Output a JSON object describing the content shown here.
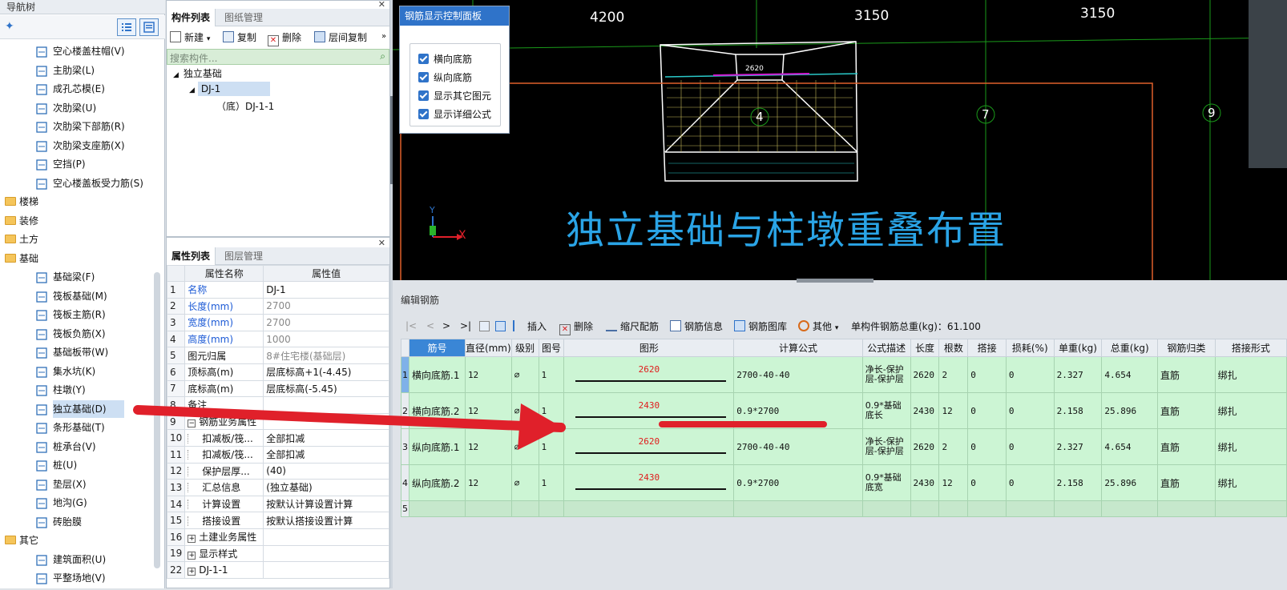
{
  "nav": {
    "title": "导航树",
    "items": [
      {
        "label": "空心楼盖柱帽(V)",
        "icon": "column-cap-icon"
      },
      {
        "label": "主肋梁(L)",
        "icon": "main-rib-beam-icon"
      },
      {
        "label": "成孔芯模(E)",
        "icon": "hole-core-mold-icon"
      },
      {
        "label": "次肋梁(U)",
        "icon": "secondary-rib-beam-icon"
      },
      {
        "label": "次肋梁下部筋(R)",
        "icon": "beam-bottom-rebar-icon"
      },
      {
        "label": "次肋梁支座筋(X)",
        "icon": "beam-support-rebar-icon"
      },
      {
        "label": "空挡(P)",
        "icon": "gap-icon"
      },
      {
        "label": "空心楼盖板受力筋(S)",
        "icon": "slab-rebar-icon"
      }
    ],
    "groups_top": [
      {
        "label": "楼梯"
      },
      {
        "label": "装修"
      },
      {
        "label": "土方"
      },
      {
        "label": "基础"
      }
    ],
    "foundation_items": [
      {
        "label": "基础梁(F)",
        "icon": "foundation-beam-icon"
      },
      {
        "label": "筏板基础(M)",
        "icon": "raft-foundation-icon"
      },
      {
        "label": "筏板主筋(R)",
        "icon": "raft-main-rebar-icon"
      },
      {
        "label": "筏板负筋(X)",
        "icon": "raft-negative-rebar-icon"
      },
      {
        "label": "基础板带(W)",
        "icon": "foundation-strip-icon"
      },
      {
        "label": "集水坑(K)",
        "icon": "sump-icon"
      },
      {
        "label": "柱墩(Y)",
        "icon": "column-pier-icon"
      },
      {
        "label": "独立基础(D)",
        "icon": "isolated-footing-icon",
        "selected": true
      },
      {
        "label": "条形基础(T)",
        "icon": "strip-footing-icon"
      },
      {
        "label": "桩承台(V)",
        "icon": "pile-cap-icon"
      },
      {
        "label": "桩(U)",
        "icon": "pile-icon"
      },
      {
        "label": "垫层(X)",
        "icon": "cushion-icon"
      },
      {
        "label": "地沟(G)",
        "icon": "trench-icon"
      },
      {
        "label": "砖胎膜",
        "icon": "brick-mold-icon"
      }
    ],
    "group_other": "其它",
    "other_items": [
      {
        "label": "建筑面积(U)",
        "icon": "building-area-icon"
      },
      {
        "label": "平整场地(V)",
        "icon": "site-leveling-icon"
      }
    ]
  },
  "component": {
    "tabs": [
      "构件列表",
      "图纸管理"
    ],
    "toolbar": {
      "new": "新建",
      "copy": "复制",
      "delete": "删除",
      "floor_copy": "层间复制"
    },
    "search_placeholder": "搜索构件...",
    "tree": {
      "root": "独立基础",
      "child": "DJ-1",
      "leaf": "（底）DJ-1-1"
    }
  },
  "properties": {
    "tabs": [
      "属性列表",
      "图层管理"
    ],
    "header": {
      "name": "属性名称",
      "value": "属性值"
    },
    "rows": [
      {
        "n": "1",
        "name": "名称",
        "value": "DJ-1",
        "blue": true
      },
      {
        "n": "2",
        "name": "长度(mm)",
        "value": "2700",
        "blue": true,
        "gray": true
      },
      {
        "n": "3",
        "name": "宽度(mm)",
        "value": "2700",
        "blue": true,
        "gray": true
      },
      {
        "n": "4",
        "name": "高度(mm)",
        "value": "1000",
        "blue": true,
        "gray": true
      },
      {
        "n": "5",
        "name": "图元归属",
        "value": "8#住宅楼(基础层)",
        "gray": true
      },
      {
        "n": "6",
        "name": "顶标高(m)",
        "value": "层底标高+1(-4.45)"
      },
      {
        "n": "7",
        "name": "底标高(m)",
        "value": "层底标高(-5.45)"
      },
      {
        "n": "8",
        "name": "备注",
        "value": ""
      },
      {
        "n": "9",
        "name": "钢筋业务属性",
        "value": "",
        "expand": "−"
      },
      {
        "n": "10",
        "name": "扣减板/筏...",
        "value": "全部扣减",
        "indent": true
      },
      {
        "n": "11",
        "name": "扣减板/筏...",
        "value": "全部扣减",
        "indent": true
      },
      {
        "n": "12",
        "name": "保护层厚...",
        "value": "(40)",
        "indent": true
      },
      {
        "n": "13",
        "name": "汇总信息",
        "value": "(独立基础)",
        "indent": true
      },
      {
        "n": "14",
        "name": "计算设置",
        "value": "按默认计算设置计算",
        "indent": true
      },
      {
        "n": "15",
        "name": "搭接设置",
        "value": "按默认搭接设置计算",
        "indent": true
      },
      {
        "n": "16",
        "name": "土建业务属性",
        "value": "",
        "expand": "+"
      },
      {
        "n": "19",
        "name": "显示样式",
        "value": "",
        "expand": "+"
      },
      {
        "n": "22",
        "name": "DJ-1-1",
        "value": "",
        "expand": "+"
      }
    ]
  },
  "viewport": {
    "dims": [
      "4200",
      "3150",
      "3150"
    ],
    "axis_labels": [
      "4",
      "7",
      "9"
    ],
    "shape_dim": "2620",
    "caption": "独立基础与柱墩重叠布置",
    "axis_x": "X",
    "axis_y": "Y"
  },
  "control_panel": {
    "title": "钢筋显示控制面板",
    "options": [
      "横向底筋",
      "纵向底筋",
      "显示其它图元",
      "显示详细公式"
    ]
  },
  "editor": {
    "title": "编辑钢筋",
    "toolbar": {
      "insert": "插入",
      "delete": "删除",
      "scale": "缩尺配筋",
      "info": "钢筋信息",
      "library": "钢筋图库",
      "other": "其他",
      "total": "单构件钢筋总重(kg)：61.100"
    },
    "columns": [
      "筋号",
      "直径(mm)",
      "级别",
      "图号",
      "图形",
      "计算公式",
      "公式描述",
      "长度",
      "根数",
      "搭接",
      "损耗(%)",
      "单重(kg)",
      "总重(kg)",
      "钢筋归类",
      "搭接形式"
    ],
    "rows": [
      {
        "n": "1",
        "name": "横向底筋.1",
        "dia": "12",
        "grade": "⌀",
        "fig": "1",
        "shape": "2620",
        "formula": "2700-40-40",
        "desc": "净长-保护层-保护层",
        "len": "2620",
        "count": "2",
        "lap": "0",
        "loss": "0",
        "unit": "2.327",
        "total": "4.654",
        "type": "直筋",
        "lapform": "绑扎"
      },
      {
        "n": "2",
        "name": "横向底筋.2",
        "dia": "12",
        "grade": "⌀",
        "fig": "1",
        "shape": "2430",
        "formula": "0.9*2700",
        "desc": "0.9*基础底长",
        "len": "2430",
        "count": "12",
        "lap": "0",
        "loss": "0",
        "unit": "2.158",
        "total": "25.896",
        "type": "直筋",
        "lapform": "绑扎"
      },
      {
        "n": "3",
        "name": "纵向底筋.1",
        "dia": "12",
        "grade": "⌀",
        "fig": "1",
        "shape": "2620",
        "formula": "2700-40-40",
        "desc": "净长-保护层-保护层",
        "len": "2620",
        "count": "2",
        "lap": "0",
        "loss": "0",
        "unit": "2.327",
        "total": "4.654",
        "type": "直筋",
        "lapform": "绑扎"
      },
      {
        "n": "4",
        "name": "纵向底筋.2",
        "dia": "12",
        "grade": "⌀",
        "fig": "1",
        "shape": "2430",
        "formula": "0.9*2700",
        "desc": "0.9*基础底宽",
        "len": "2430",
        "count": "12",
        "lap": "0",
        "loss": "0",
        "unit": "2.158",
        "total": "25.896",
        "type": "直筋",
        "lapform": "绑扎"
      }
    ],
    "empty_row": "5"
  },
  "colors": {
    "accent": "#2f73c9",
    "caption": "#2aa4e6",
    "annotation": "#e0202a",
    "grid_row": "#ccf5d4"
  }
}
